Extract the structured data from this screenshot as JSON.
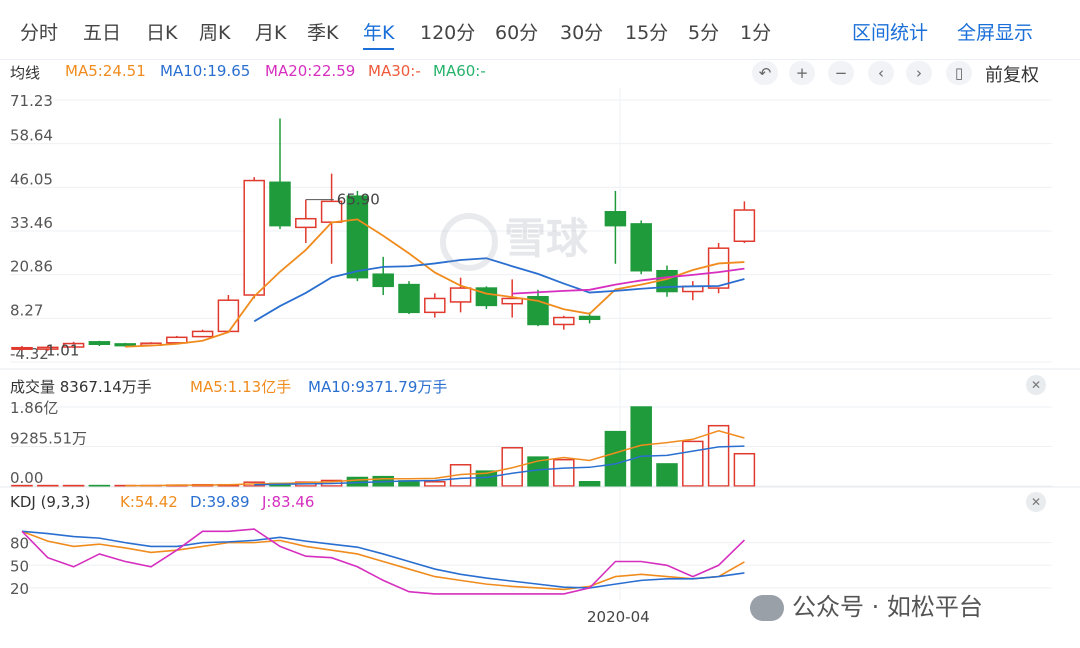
{
  "tabs": [
    {
      "label": "分时",
      "active": false
    },
    {
      "label": "五日",
      "active": false
    },
    {
      "label": "日K",
      "active": false
    },
    {
      "label": "周K",
      "active": false
    },
    {
      "label": "月K",
      "active": false
    },
    {
      "label": "季K",
      "active": false
    },
    {
      "label": "年K",
      "active": true
    },
    {
      "label": "120分",
      "active": false
    },
    {
      "label": "60分",
      "active": false
    },
    {
      "label": "30分",
      "active": false
    },
    {
      "label": "15分",
      "active": false
    },
    {
      "label": "5分",
      "active": false
    },
    {
      "label": "1分",
      "active": false
    }
  ],
  "right_actions": {
    "interval_stats": "区间统计",
    "fullscreen": "全屏显示"
  },
  "ma_row": {
    "title": "均线",
    "items": [
      {
        "text": "MA5:24.51",
        "color": "#f08c1e"
      },
      {
        "text": "MA10:19.65",
        "color": "#2a6fd0"
      },
      {
        "text": "MA20:22.59",
        "color": "#d62fbf"
      },
      {
        "text": "MA30:-",
        "color": "#ee5a3b"
      },
      {
        "text": "MA60:-",
        "color": "#25b36b"
      }
    ]
  },
  "controls": {
    "icons": [
      "undo-icon",
      "zoom-in-icon",
      "zoom-out-icon",
      "prev-icon",
      "next-icon",
      "candle-icon"
    ],
    "glyphs": [
      "↶",
      "+",
      "−",
      "‹",
      "›",
      "▯"
    ],
    "adjust_label": "前复权"
  },
  "volume_header": {
    "title": "成交量 8367.14万手",
    "ma5": "MA5:1.13亿手",
    "ma10": "MA10:9371.79万手",
    "ma5_color": "#f08c1e",
    "ma10_color": "#2a6fd0"
  },
  "kdj_header": {
    "title": "KDJ (9,3,3)",
    "k": "K:54.42",
    "d": "D:39.89",
    "j": "J:83.46",
    "k_color": "#f08c1e",
    "d_color": "#2a6fd0",
    "j_color": "#d62fbf"
  },
  "x_axis_label": "2020-04",
  "watermark_text": "雪球",
  "social_text": "公众号 · 如松平台",
  "colors": {
    "up": "#e03a2f",
    "down": "#1f9b3c",
    "grid": "#eef0f3"
  },
  "chart_data": [
    {
      "type": "candlestick",
      "title": "",
      "ylim": [
        -4.32,
        71.23
      ],
      "y_ticks": [
        "71.23",
        "58.64",
        "46.05",
        "33.46",
        "20.86",
        "8.27",
        "-4.32"
      ],
      "annotations": [
        {
          "text": "65.90",
          "index": 11
        },
        {
          "text": "1.01",
          "index": 0
        }
      ],
      "candles": [
        {
          "o": -0.5,
          "c": -0.2,
          "h": 0.3,
          "l": -1.0
        },
        {
          "o": -0.6,
          "c": -0.1,
          "h": 0.4,
          "l": -1.1
        },
        {
          "o": 0.0,
          "c": 1.0,
          "h": 1.5,
          "l": -0.3
        },
        {
          "o": 1.5,
          "c": 0.8,
          "h": 1.8,
          "l": 0.3
        },
        {
          "o": 0.9,
          "c": 0.4,
          "h": 1.2,
          "l": 0.1
        },
        {
          "o": 0.5,
          "c": 1.1,
          "h": 1.4,
          "l": 0.2
        },
        {
          "o": 1.2,
          "c": 2.8,
          "h": 3.2,
          "l": 0.9
        },
        {
          "o": 3.0,
          "c": 4.5,
          "h": 5.0,
          "l": 2.8
        },
        {
          "o": 4.5,
          "c": 13.5,
          "h": 15.0,
          "l": 4.0
        },
        {
          "o": 15.0,
          "c": 48.0,
          "h": 49.0,
          "l": 14.0
        },
        {
          "o": 47.5,
          "c": 35.0,
          "h": 65.9,
          "l": 34.0
        },
        {
          "o": 34.5,
          "c": 37.0,
          "h": 42.5,
          "l": 30.0
        },
        {
          "o": 36.0,
          "c": 42.0,
          "h": 50.0,
          "l": 24.0
        },
        {
          "o": 43.5,
          "c": 20.0,
          "h": 45.0,
          "l": 19.0
        },
        {
          "o": 21.0,
          "c": 17.5,
          "h": 26.0,
          "l": 15.0
        },
        {
          "o": 18.0,
          "c": 10.0,
          "h": 19.0,
          "l": 9.5
        },
        {
          "o": 10.0,
          "c": 14.0,
          "h": 15.5,
          "l": 8.5
        },
        {
          "o": 13.0,
          "c": 17.0,
          "h": 20.0,
          "l": 10.0
        },
        {
          "o": 17.0,
          "c": 12.0,
          "h": 17.5,
          "l": 11.0
        },
        {
          "o": 12.5,
          "c": 14.0,
          "h": 19.5,
          "l": 8.5
        },
        {
          "o": 14.5,
          "c": 6.5,
          "h": 16.5,
          "l": 6.0
        },
        {
          "o": 6.5,
          "c": 8.5,
          "h": 9.0,
          "l": 5.0
        },
        {
          "o": 8.8,
          "c": 8.0,
          "h": 10.0,
          "l": 6.8
        },
        {
          "o": 39.0,
          "c": 35.0,
          "h": 45.0,
          "l": 24.0
        },
        {
          "o": 35.5,
          "c": 22.0,
          "h": 36.5,
          "l": 21.0
        },
        {
          "o": 22.0,
          "c": 16.0,
          "h": 23.5,
          "l": 14.5
        },
        {
          "o": 16.0,
          "c": 17.5,
          "h": 19.0,
          "l": 13.5
        },
        {
          "o": 17.0,
          "c": 28.5,
          "h": 30.0,
          "l": 15.5
        },
        {
          "o": 30.5,
          "c": 39.5,
          "h": 42.0,
          "l": 30.0
        }
      ],
      "series": [
        {
          "name": "MA5",
          "color": "#f08c1e",
          "values": [
            null,
            null,
            null,
            null,
            0.1,
            0.4,
            0.9,
            1.8,
            4.3,
            14.6,
            21.7,
            28.0,
            35.9,
            36.8,
            32.1,
            27.0,
            21.5,
            17.7,
            15.4,
            14.4,
            13.3,
            10.9,
            9.6,
            16.6,
            18.0,
            19.6,
            22.2,
            24.1,
            24.5
          ]
        },
        {
          "name": "MA10",
          "color": "#2a6fd0",
          "values": [
            null,
            null,
            null,
            null,
            null,
            null,
            null,
            null,
            null,
            7.4,
            11.8,
            15.6,
            20.1,
            21.9,
            23.1,
            23.3,
            24.1,
            25.1,
            25.6,
            23.3,
            21.1,
            18.3,
            15.7,
            16.2,
            16.8,
            17.3,
            17.5,
            17.6,
            19.6
          ]
        },
        {
          "name": "MA20",
          "color": "#d62fbf",
          "values": [
            null,
            null,
            null,
            null,
            null,
            null,
            null,
            null,
            null,
            null,
            null,
            null,
            null,
            null,
            null,
            null,
            null,
            null,
            null,
            15.4,
            15.8,
            16.2,
            16.5,
            18.0,
            19.2,
            20.1,
            20.8,
            21.6,
            22.6
          ]
        }
      ]
    },
    {
      "type": "bar",
      "title": "成交量",
      "ylim": [
        0,
        1.86
      ],
      "unit": "亿手",
      "y_ticks": [
        "1.86亿",
        "9285.51万",
        "0.00"
      ],
      "values": [
        0.01,
        0.01,
        0.01,
        0.01,
        0.01,
        0.01,
        0.02,
        0.03,
        0.03,
        0.09,
        0.06,
        0.09,
        0.13,
        0.2,
        0.22,
        0.12,
        0.1,
        0.5,
        0.35,
        0.9,
        0.68,
        0.62,
        0.1,
        1.28,
        1.86,
        0.52,
        1.05,
        1.42,
        0.76
      ],
      "up": [
        true,
        true,
        true,
        false,
        true,
        true,
        true,
        true,
        true,
        true,
        false,
        true,
        true,
        false,
        false,
        false,
        true,
        true,
        false,
        true,
        false,
        true,
        false,
        false,
        false,
        false,
        true,
        true,
        true
      ],
      "series": [
        {
          "name": "MA5",
          "color": "#f08c1e",
          "values": [
            null,
            null,
            null,
            null,
            0.01,
            0.01,
            0.02,
            0.02,
            0.03,
            0.05,
            0.06,
            0.08,
            0.1,
            0.14,
            0.17,
            0.17,
            0.18,
            0.27,
            0.3,
            0.43,
            0.59,
            0.67,
            0.6,
            0.78,
            0.96,
            1.02,
            1.1,
            1.3,
            1.13
          ]
        },
        {
          "name": "MA10",
          "color": "#2a6fd0",
          "values": [
            null,
            null,
            null,
            null,
            null,
            null,
            null,
            null,
            null,
            0.03,
            0.04,
            0.05,
            0.06,
            0.08,
            0.1,
            0.12,
            0.13,
            0.18,
            0.2,
            0.3,
            0.38,
            0.42,
            0.44,
            0.52,
            0.7,
            0.72,
            0.82,
            0.92,
            0.94
          ]
        }
      ]
    },
    {
      "type": "line",
      "title": "KDJ (9,3,3)",
      "ylim": [
        0,
        110
      ],
      "y_ticks": [
        "80",
        "50",
        "20"
      ],
      "series": [
        {
          "name": "K",
          "color": "#f08c1e",
          "values": [
            95,
            82,
            75,
            78,
            73,
            67,
            70,
            75,
            80,
            80,
            83,
            75,
            70,
            65,
            55,
            45,
            35,
            30,
            25,
            22,
            20,
            18,
            22,
            35,
            38,
            35,
            32,
            35,
            54.42
          ]
        },
        {
          "name": "D",
          "color": "#2a6fd0",
          "values": [
            95,
            92,
            88,
            86,
            80,
            75,
            75,
            80,
            81,
            83,
            87,
            82,
            78,
            74,
            65,
            55,
            45,
            38,
            33,
            29,
            25,
            21,
            20,
            25,
            30,
            32,
            32,
            35,
            39.89
          ]
        },
        {
          "name": "J",
          "color": "#d62fbf",
          "values": [
            95,
            60,
            48,
            65,
            55,
            48,
            70,
            95,
            95,
            98,
            75,
            62,
            60,
            48,
            30,
            15,
            12,
            12,
            12,
            12,
            12,
            12,
            20,
            55,
            55,
            50,
            35,
            50,
            83.46
          ]
        }
      ]
    }
  ]
}
